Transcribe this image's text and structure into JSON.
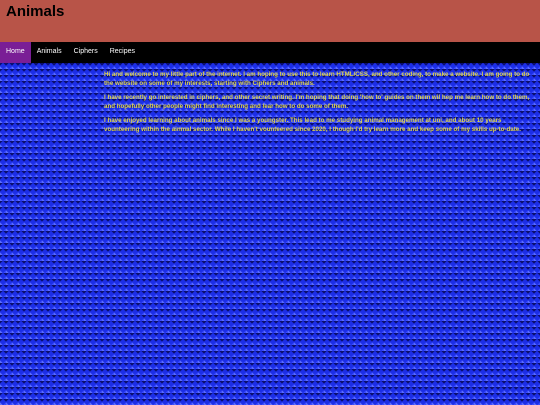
{
  "header": {
    "title": "Animals"
  },
  "nav": {
    "items": [
      {
        "label": "Home",
        "active": true
      },
      {
        "label": "Animals",
        "active": false
      },
      {
        "label": "Ciphers",
        "active": false
      },
      {
        "label": "Recipes",
        "active": false
      }
    ]
  },
  "main": {
    "paragraphs": [
      "Hi and welcome to my little part of the internet. I am hoping to use this to learn HTML/CSS, and other coding, to make a website. I am going to do the website on some of my interests, starting with Ciphers and animals.",
      "I have recently go interested in ciphers, and other secret writing. I'm hoping that doing 'how to' guides on them wil hep me learn how to do them, and hopefully other people might find interesting and lear how to do some of them.",
      "I have enjoyed learning about animals since I was a youngster. This lead to me studying animal management at uni, and about 10 years vounteering within the ainmal sector. While I haven't vounteered since 2020, I though I'd try learn more and keep some of my skills up-to-date."
    ]
  },
  "colors": {
    "header_bg": "#b85448",
    "nav_bg": "#000000",
    "nav_active_bg": "#7a1e96",
    "text": "#e0d54a",
    "pattern_base": "#1c2ee6"
  }
}
